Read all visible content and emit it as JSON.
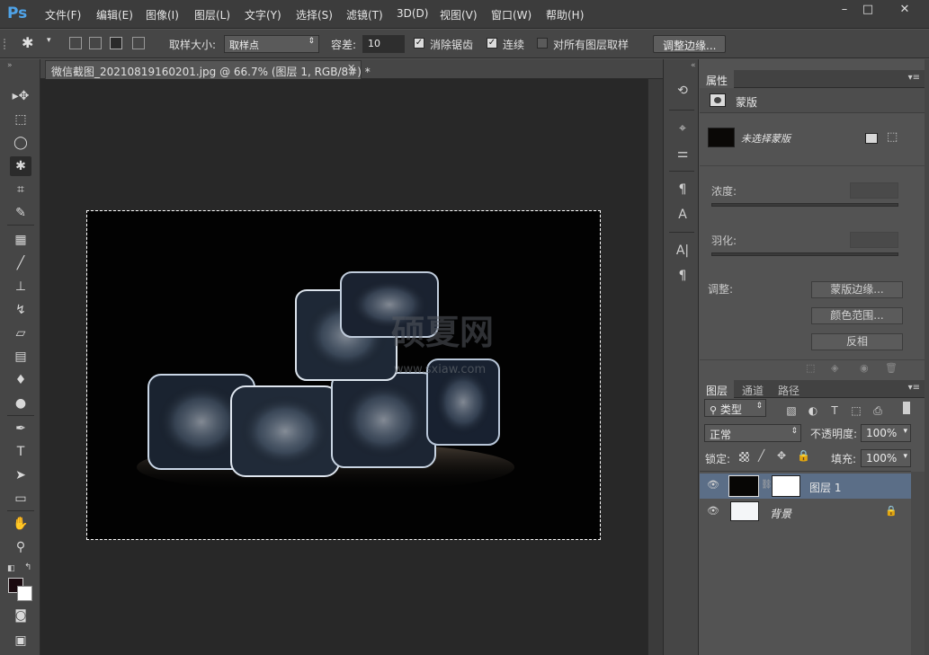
{
  "app": {
    "logo": "Ps"
  },
  "menu": [
    "文件(F)",
    "编辑(E)",
    "图像(I)",
    "图层(L)",
    "文字(Y)",
    "选择(S)",
    "滤镜(T)",
    "3D(D)",
    "视图(V)",
    "窗口(W)",
    "帮助(H)"
  ],
  "window_controls": {
    "minimize": "–",
    "maximize": "□",
    "close": "✕"
  },
  "options": {
    "sample_size_label": "取样大小:",
    "sample_size_value": "取样点",
    "tolerance_label": "容差:",
    "tolerance_value": "10",
    "antialias_label": "消除锯齿",
    "antialias_checked": true,
    "contiguous_label": "连续",
    "contiguous_checked": true,
    "all_layers_label": "对所有图层取样",
    "all_layers_checked": false,
    "refine_edge_label": "调整边缘..."
  },
  "document": {
    "tab_title": "微信截图_20210819160201.jpg @ 66.7% (图层 1, RGB/8#) *",
    "watermark_text": "硕夏网",
    "watermark_url": "www.sxiaw.com"
  },
  "properties_panel": {
    "tab_label": "属性",
    "section_title": "蒙版",
    "mask_status": "未选择蒙版",
    "density_label": "浓度:",
    "feather_label": "羽化:",
    "adjust_label": "调整:",
    "mask_edge_button": "蒙版边缘...",
    "color_range_button": "颜色范围...",
    "invert_button": "反相"
  },
  "layers_panel": {
    "tabs": [
      "图层",
      "通道",
      "路径"
    ],
    "filter_kind": "类型",
    "blend_mode": "正常",
    "opacity_label": "不透明度:",
    "opacity_value": "100%",
    "lock_label": "锁定:",
    "fill_label": "填充:",
    "fill_value": "100%",
    "layers": [
      {
        "name": "图层 1",
        "selected": true
      },
      {
        "name": "背景",
        "selected": false,
        "locked": true
      }
    ]
  },
  "colors": {
    "foreground": "#1a0a0f",
    "background": "#ffffff",
    "selection_highlight": "#5b6e87",
    "ps_logo": "#4fa3e8"
  }
}
